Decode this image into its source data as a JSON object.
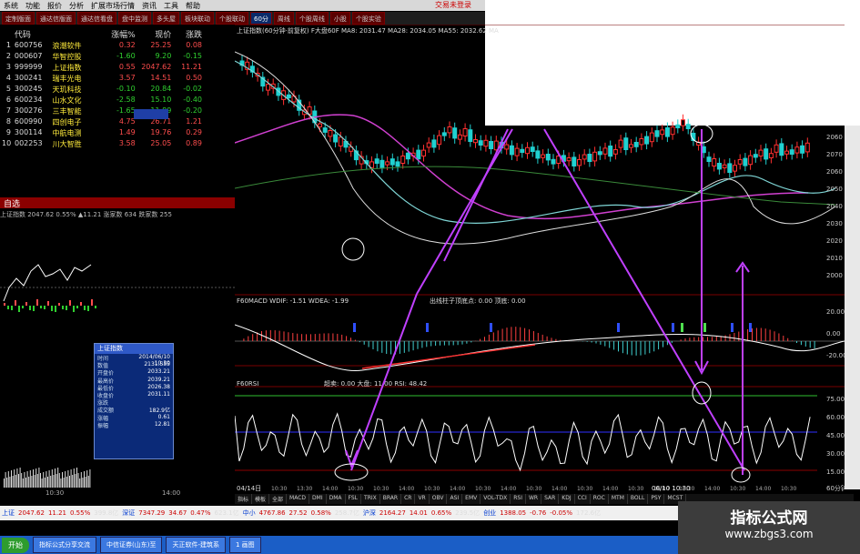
{
  "menu": {
    "items": [
      "系统",
      "功能",
      "报价",
      "分析",
      "扩展市场行情",
      "资讯",
      "工具",
      "帮助"
    ],
    "right": "交易未登录"
  },
  "tabs": [
    "定制版面",
    "通达信版面",
    "通达信看盘",
    "盘中监测",
    "多头屋",
    "板块联动",
    "个股联动",
    "60分",
    "周线",
    "个股周线",
    "小股",
    "个股实验"
  ],
  "stock_table": {
    "headers": [
      "代码",
      "涨幅%",
      "现价",
      "涨跌"
    ],
    "rows": [
      {
        "n": "1",
        "code": "600756",
        "name": "浪潮软件",
        "pct": "0.32",
        "price": "25.25",
        "chg": "0.08",
        "dir": "up"
      },
      {
        "n": "2",
        "code": "000607",
        "name": "华智控股",
        "pct": "-1.60",
        "price": "9.20",
        "chg": "-0.15",
        "dir": "dn"
      },
      {
        "n": "3",
        "code": "999999",
        "name": "上证指数",
        "pct": "0.55",
        "price": "2047.62",
        "chg": "11.21",
        "dir": "up"
      },
      {
        "n": "4",
        "code": "300241",
        "name": "瑞丰光电",
        "pct": "3.57",
        "price": "14.51",
        "chg": "0.50",
        "dir": "up"
      },
      {
        "n": "5",
        "code": "300245",
        "name": "天玑科技",
        "pct": "-0.10",
        "price": "20.84",
        "chg": "-0.02",
        "dir": "dn"
      },
      {
        "n": "6",
        "code": "600234",
        "name": "山水文化",
        "pct": "-2.58",
        "price": "15.10",
        "chg": "-0.40",
        "dir": "dn"
      },
      {
        "n": "7",
        "code": "300276",
        "name": "三丰智能",
        "pct": "-1.65",
        "price": "11.89",
        "chg": "-0.20",
        "dir": "dn"
      },
      {
        "n": "8",
        "code": "600990",
        "name": "四创电子",
        "pct": "4.75",
        "price": "26.71",
        "chg": "1.21",
        "dir": "up"
      },
      {
        "n": "9",
        "code": "300114",
        "name": "中航电测",
        "pct": "1.49",
        "price": "19.76",
        "chg": "0.29",
        "dir": "up"
      },
      {
        "n": "10",
        "code": "002253",
        "name": "川大智胜",
        "pct": "3.58",
        "price": "25.05",
        "chg": "0.89",
        "dir": "up"
      }
    ]
  },
  "panel": {
    "title": "自选",
    "mini_header": "上证指数 2047.62 0.55% ▲11.21 涨家数 634 跌家数 255",
    "xlabels": [
      "10:30",
      "14:00"
    ]
  },
  "info_box": {
    "title": "上证指数",
    "rows": [
      {
        "k": "时间",
        "v": "2014/06/10 10:30"
      },
      {
        "k": "数值",
        "v": "2131.555"
      },
      {
        "k": "开盘价",
        "v": "2033.21"
      },
      {
        "k": "最高价",
        "v": "2039.21"
      },
      {
        "k": "最低价",
        "v": "2026.38"
      },
      {
        "k": "收盘价",
        "v": "2031.11"
      },
      {
        "k": "涨跌",
        "v": ""
      },
      {
        "k": "成交额",
        "v": "182.9亿"
      },
      {
        "k": "涨幅",
        "v": "0.61"
      },
      {
        "k": "振幅",
        "v": "12.81"
      }
    ]
  },
  "chart": {
    "title": "上证指数(60分钟·前复权) F大盘60F MA8: 2031.47 MA28: 2034.05 MA55: 2032.62 MA",
    "macd_label": "F60MACD WDIF: -1.51 WDEA: -1.99",
    "macd_extra": "出线柱子顶底点: 0.00  顶底: 0.00",
    "rsi_label": "F60RSI",
    "rsi_extra": "超卖: 0.00 大盘: 11.00 RSI: 48.42",
    "yaxis": [
      "2060",
      "2070",
      "2060",
      "2050",
      "2040",
      "2030",
      "2020",
      "2010",
      "2000"
    ],
    "macd_axis": [
      "20.00",
      "0.00",
      "-20.00"
    ],
    "rsi_axis": [
      "75.00",
      "60.00",
      "45.00",
      "30.00",
      "15.00"
    ],
    "date_left": "04/14日",
    "date_mid": "06/10 10:30",
    "xlabels": [
      "10:30",
      "13:30",
      "14:00",
      "10:30",
      "10:30",
      "14:00",
      "10:30",
      "14:00",
      "10:30",
      "14:00",
      "10:30",
      "14:00",
      "10:30",
      "14:00",
      "10:30",
      "14:00",
      "10:30",
      "14:00",
      "10:30",
      "14:00",
      "10:30"
    ],
    "period": "60分钟"
  },
  "bottom_tabs": [
    "指标",
    "模板",
    "全部",
    "MACD",
    "DMI",
    "DMA",
    "FSL",
    "TRIX",
    "BRAR",
    "CR",
    "VR",
    "OBV",
    "ASI",
    "EMV",
    "VOL-TDX",
    "RSI",
    "WR",
    "SAR",
    "KDJ",
    "CCI",
    "ROC",
    "MTM",
    "BOLL",
    "PSY",
    "MCST"
  ],
  "status": {
    "items": [
      {
        "lbl": "上证",
        "val": "2047.62",
        "c1": "11.21",
        "c2": "0.55%",
        "amt": "399.8亿"
      },
      {
        "lbl": "深证",
        "val": "7347.29",
        "c1": "34.67",
        "c2": "0.47%",
        "amt": "623.1亿"
      },
      {
        "lbl": "中小",
        "val": "4767.86",
        "c1": "27.52",
        "c2": "0.58%",
        "amt": "258.7亿"
      },
      {
        "lbl": "沪深",
        "val": "2164.27",
        "c1": "14.01",
        "c2": "0.65%",
        "amt": "239.5亿"
      },
      {
        "lbl": "创业",
        "val": "1388.05",
        "c1": "-0.76",
        "c2": "-0.05%",
        "amt": "172.6亿"
      }
    ]
  },
  "taskbar": {
    "start": "开始",
    "tasks": [
      "指标公式分享交流",
      "中信证券(山东)至",
      "天正软件-建筑系",
      "1 画图"
    ]
  },
  "watermark": {
    "line1": "指标公式网",
    "line2": "www.zbgs3.com"
  }
}
